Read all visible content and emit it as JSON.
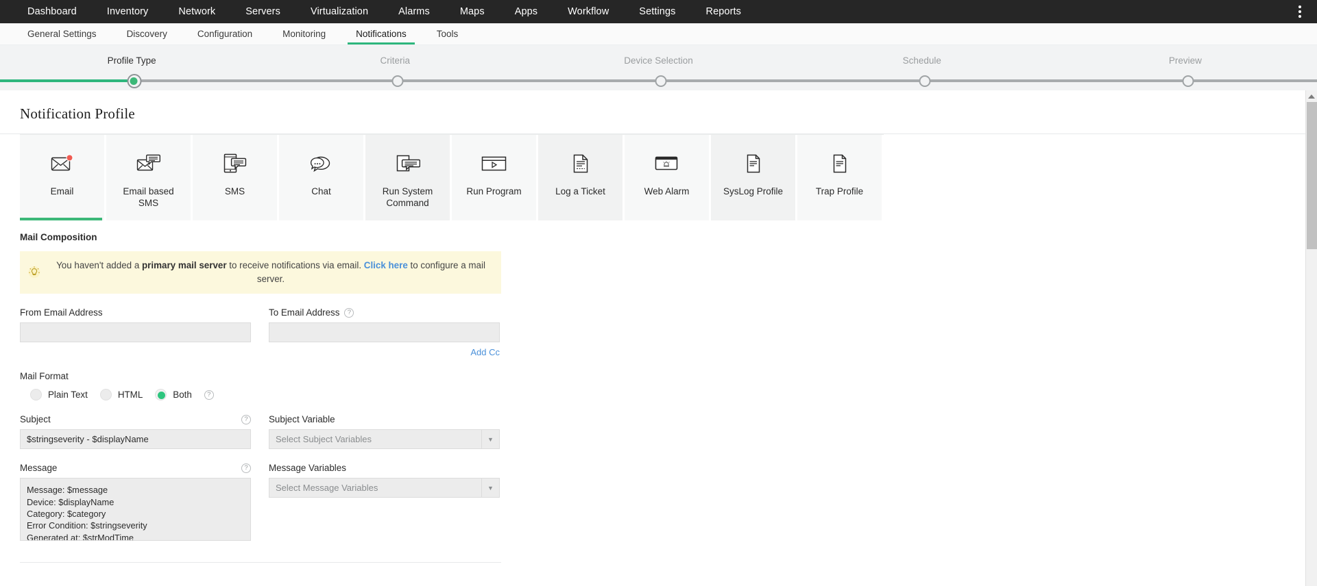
{
  "topnav": {
    "items": [
      {
        "label": "Dashboard"
      },
      {
        "label": "Inventory"
      },
      {
        "label": "Network"
      },
      {
        "label": "Servers"
      },
      {
        "label": "Virtualization"
      },
      {
        "label": "Alarms"
      },
      {
        "label": "Maps"
      },
      {
        "label": "Apps"
      },
      {
        "label": "Workflow"
      },
      {
        "label": "Settings"
      },
      {
        "label": "Reports"
      }
    ],
    "overflow_icon": "kebab-menu-icon"
  },
  "subnav": {
    "items": [
      {
        "label": "General Settings",
        "active": false
      },
      {
        "label": "Discovery",
        "active": false
      },
      {
        "label": "Configuration",
        "active": false
      },
      {
        "label": "Monitoring",
        "active": false
      },
      {
        "label": "Notifications",
        "active": true
      },
      {
        "label": "Tools",
        "active": false
      }
    ],
    "active_color": "#2eb67d"
  },
  "stepper": {
    "steps": [
      {
        "label": "Profile Type",
        "state": "active"
      },
      {
        "label": "Criteria",
        "state": "pending"
      },
      {
        "label": "Device Selection",
        "state": "pending"
      },
      {
        "label": "Schedule",
        "state": "pending"
      },
      {
        "label": "Preview",
        "state": "pending"
      }
    ],
    "progress_color": "#2eb67d",
    "track_color": "#a8abad"
  },
  "page": {
    "title": "Notification Profile"
  },
  "profile_types": [
    {
      "label": "Email",
      "icon": "envelope-alert-icon",
      "selected": true
    },
    {
      "label": "Email based SMS",
      "icon": "envelope-message-icon",
      "selected": false
    },
    {
      "label": "SMS",
      "icon": "phone-message-icon",
      "selected": false
    },
    {
      "label": "Chat",
      "icon": "chat-bubbles-icon",
      "selected": false
    },
    {
      "label": "Run System Command",
      "icon": "command-window-icon",
      "selected": false
    },
    {
      "label": "Run Program",
      "icon": "program-play-icon",
      "selected": false
    },
    {
      "label": "Log a Ticket",
      "icon": "document-lines-icon",
      "selected": false
    },
    {
      "label": "Web Alarm",
      "icon": "browser-alarm-icon",
      "selected": false
    },
    {
      "label": "SysLog Profile",
      "icon": "document-page-icon",
      "selected": false
    },
    {
      "label": "Trap Profile",
      "icon": "document-page-icon",
      "selected": false
    }
  ],
  "mail_composition": {
    "section_title": "Mail Composition",
    "warning": {
      "icon": "lightbulb-icon",
      "text_part1": "You haven't added a ",
      "bold_part": "primary mail server",
      "text_part2": " to receive notifications via email. ",
      "link_text": "Click here",
      "text_part3": " to configure a mail server.",
      "background": "#fcf8dd"
    },
    "from_email": {
      "label": "From Email Address",
      "value": "",
      "placeholder": ""
    },
    "to_email": {
      "label": "To Email Address",
      "value": "",
      "placeholder": "",
      "help": "?"
    },
    "add_cc_label": "Add Cc",
    "mail_format": {
      "label": "Mail Format",
      "help": "?",
      "options": [
        {
          "label": "Plain Text",
          "checked": false
        },
        {
          "label": "HTML",
          "checked": false
        },
        {
          "label": "Both",
          "checked": true
        }
      ],
      "selected_color": "#2ec57e"
    },
    "subject": {
      "label": "Subject",
      "help": "?",
      "value": "$stringseverity - $displayName"
    },
    "subject_variable": {
      "label": "Subject Variable",
      "selected": "Select Subject Variables",
      "arrow": "chevron-down-icon"
    },
    "message": {
      "label": "Message",
      "help": "?",
      "value": "Message: $message\nDevice: $displayName\nCategory: $category\nError Condition: $stringseverity\nGenerated at: $strModTime"
    },
    "message_variables": {
      "label": "Message Variables",
      "selected": "Select Message Variables",
      "arrow": "chevron-down-icon"
    }
  },
  "scrollbar": {
    "up_arrow": "triangle-up-icon"
  }
}
